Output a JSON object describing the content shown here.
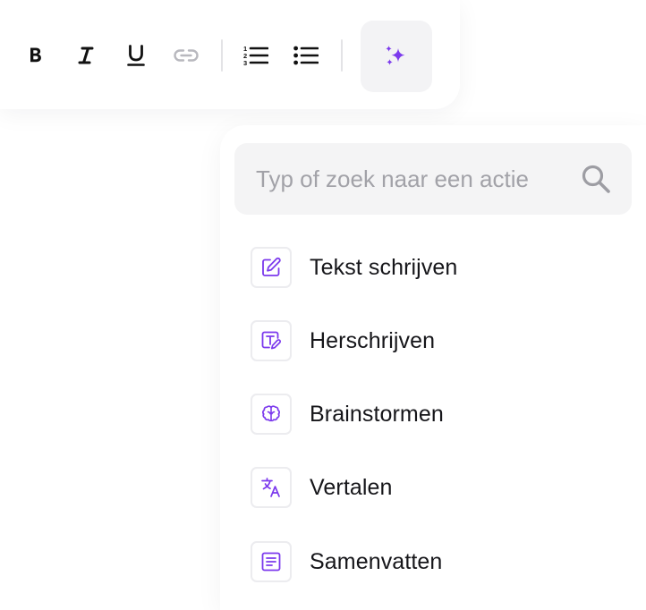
{
  "toolbar": {
    "buttons": [
      {
        "id": "bold",
        "icon": "bold-icon",
        "enabled": true
      },
      {
        "id": "italic",
        "icon": "italic-icon",
        "enabled": true
      },
      {
        "id": "underline",
        "icon": "underline-icon",
        "enabled": true
      },
      {
        "id": "link",
        "icon": "link-icon",
        "enabled": false
      },
      {
        "id": "ordered-list",
        "icon": "ordered-list-icon",
        "enabled": true
      },
      {
        "id": "bullet-list",
        "icon": "bullet-list-icon",
        "enabled": true
      }
    ],
    "ai_button": {
      "icon": "sparkles-icon",
      "active": true
    }
  },
  "search": {
    "placeholder": "Typ of zoek naar een actie",
    "value": "",
    "icon": "search-icon"
  },
  "menu": {
    "items": [
      {
        "label": "Tekst schrijven",
        "icon": "edit-icon"
      },
      {
        "label": "Herschrijven",
        "icon": "rewrite-icon"
      },
      {
        "label": "Brainstormen",
        "icon": "brain-icon"
      },
      {
        "label": "Vertalen",
        "icon": "translate-icon"
      },
      {
        "label": "Samenvatten",
        "icon": "summary-icon"
      }
    ]
  },
  "colors": {
    "accent": "#7c3aed",
    "text": "#16161a",
    "muted": "#a2a2a8",
    "disabled": "#b8b8be",
    "surface": "#f4f4f5"
  }
}
